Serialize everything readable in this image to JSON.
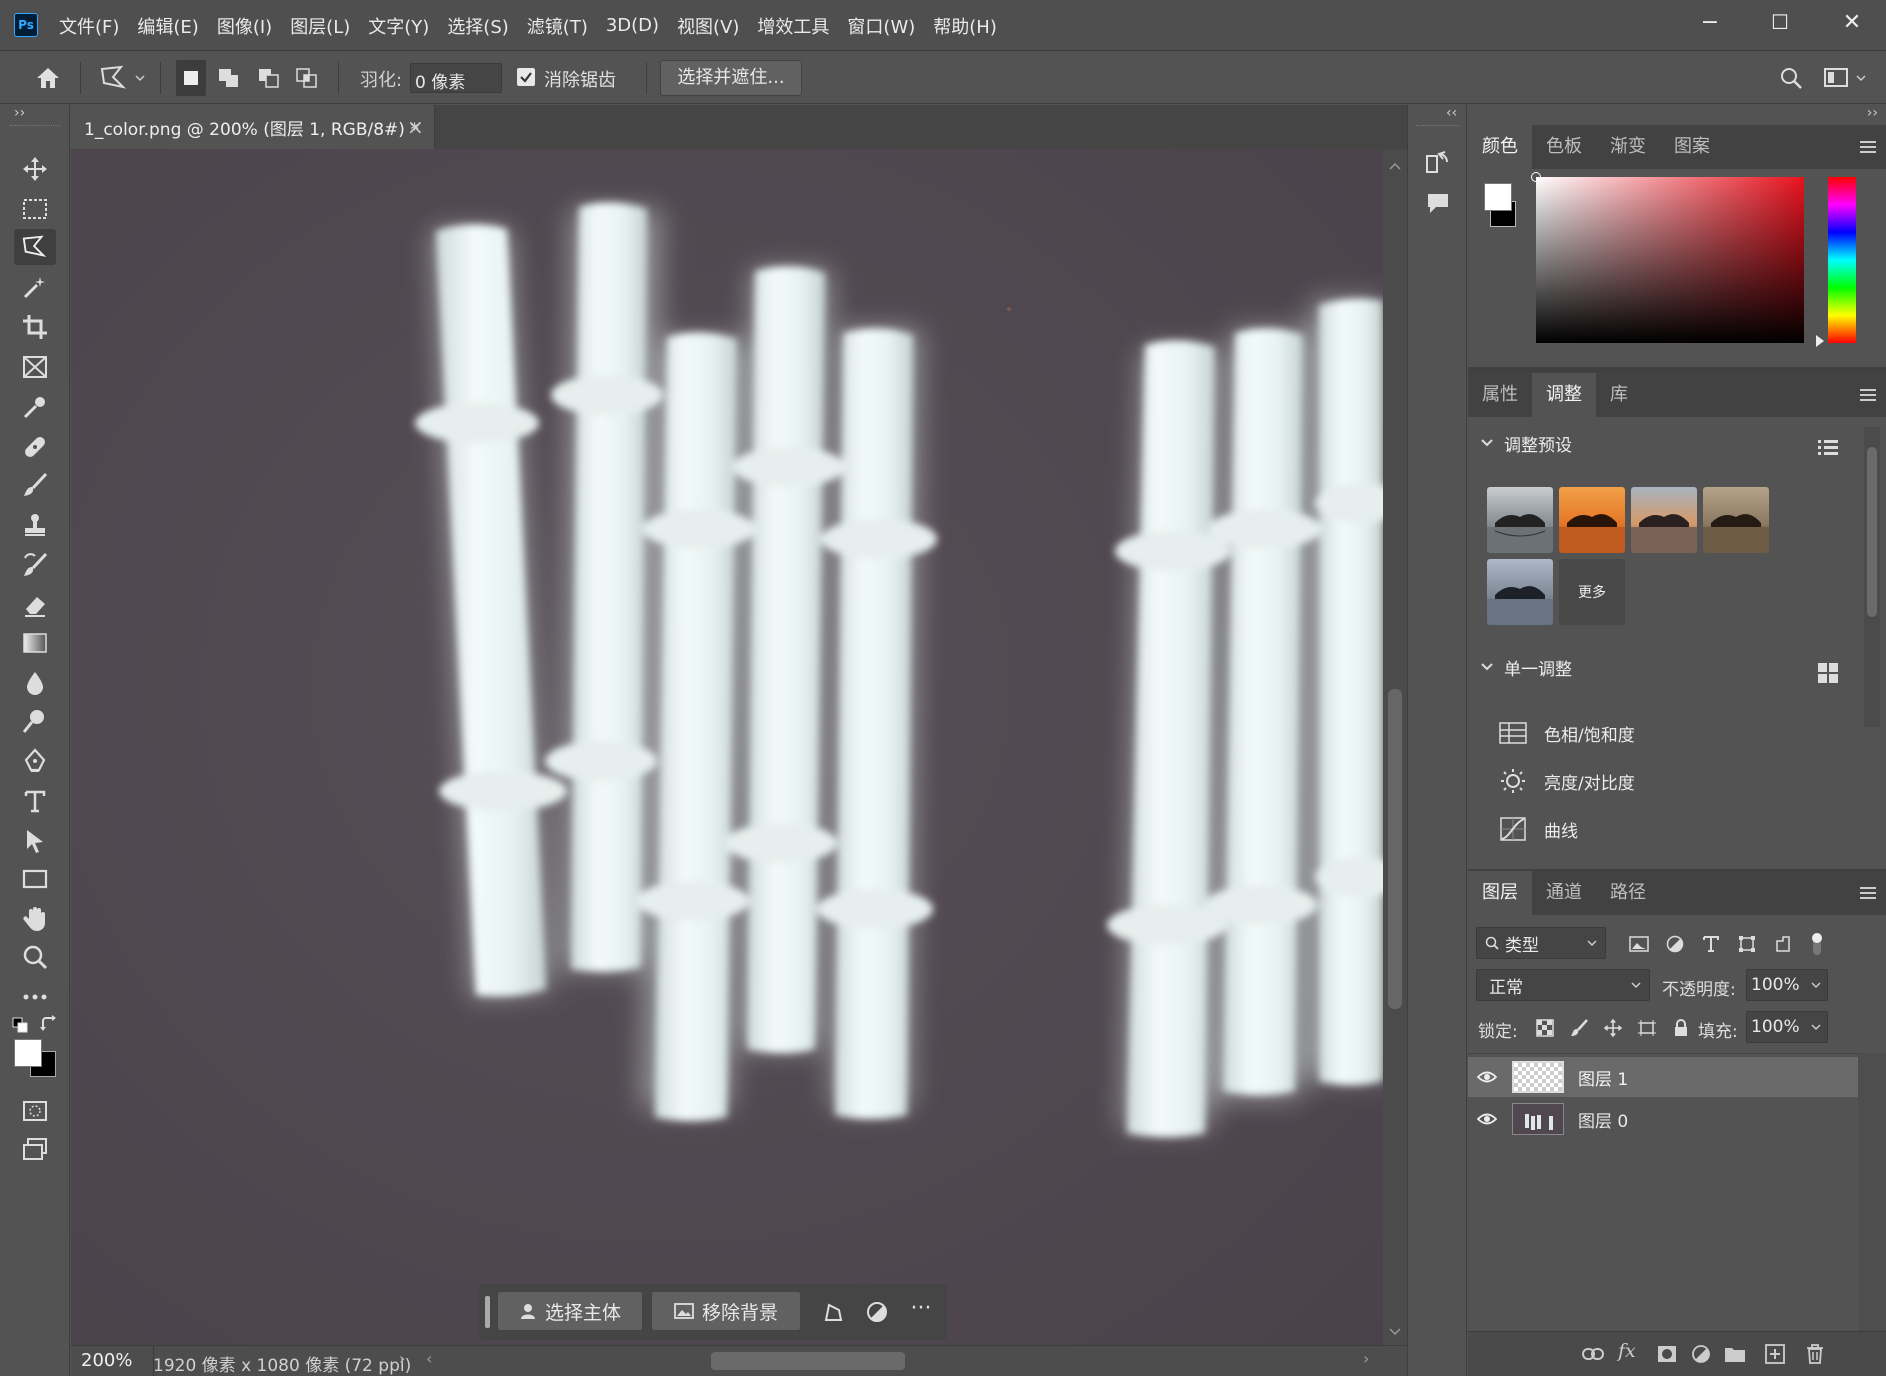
{
  "app": {
    "logo": "Ps"
  },
  "menu": [
    "文件(F)",
    "编辑(E)",
    "图像(I)",
    "图层(L)",
    "文字(Y)",
    "选择(S)",
    "滤镜(T)",
    "3D(D)",
    "视图(V)",
    "增效工具",
    "窗口(W)",
    "帮助(H)"
  ],
  "window_controls": {
    "minimize": "−",
    "maximize": "☐",
    "close": "✕"
  },
  "options": {
    "feather_label": "羽化:",
    "feather_value": "0 像素",
    "antialias_label": "消除锯齿",
    "antialias_checked": true,
    "select_mask_label": "选择并遮住..."
  },
  "document": {
    "tab_title": "1_color.png @ 200% (图层 1, RGB/8#) *",
    "close": "×",
    "zoom": "200%",
    "info": "1920 像素 x 1080 像素 (72 ppi)"
  },
  "contextual_taskbar": {
    "select_subject": "选择主体",
    "remove_background": "移除背景",
    "more": "···"
  },
  "color_panel": {
    "tabs": [
      "颜色",
      "色板",
      "渐变",
      "图案"
    ],
    "active_tab": "颜色",
    "foreground": "#ffffff",
    "background": "#000000",
    "hue_color": "#e8131f"
  },
  "adjust_panel": {
    "tabs": [
      "属性",
      "调整",
      "库"
    ],
    "active_tab": "调整",
    "presets_title": "调整预设",
    "more_label": "更多",
    "single_title": "单一调整",
    "items": [
      "色相/饱和度",
      "亮度/对比度",
      "曲线"
    ]
  },
  "layers_panel": {
    "tabs": [
      "图层",
      "通道",
      "路径"
    ],
    "active_tab": "图层",
    "filter_label": "类型",
    "blend_mode": "正常",
    "opacity_label": "不透明度:",
    "opacity_value": "100%",
    "lock_label": "锁定:",
    "fill_label": "填充:",
    "fill_value": "100%",
    "layers": [
      {
        "name": "图层 1",
        "selected": true
      },
      {
        "name": "图层 0",
        "selected": false
      }
    ]
  },
  "collapse": {
    "left": "››",
    "right_top": "‹‹",
    "right_end": "››"
  }
}
